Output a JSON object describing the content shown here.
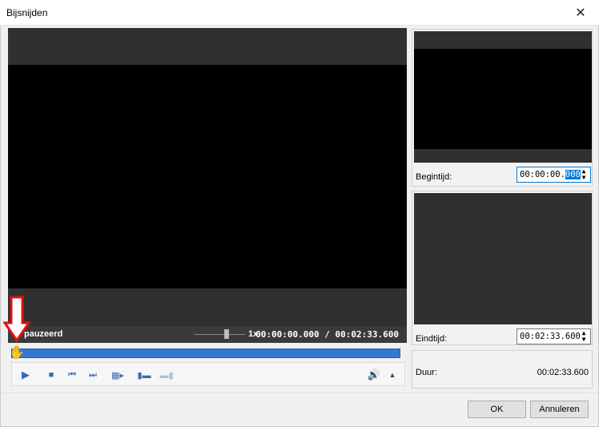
{
  "window": {
    "title": "Bijsnijden",
    "close_glyph": "✕"
  },
  "player": {
    "status": "pauzeerd",
    "speed": "1x",
    "timecode": "00:00:00.000 / 00:02:33.600",
    "seek_position": 0.0
  },
  "controls": {
    "play_icon": "▶",
    "stop_icon": "■",
    "prev_icon": "⏮",
    "next_icon": "⏭",
    "mark_icon": "▦▸",
    "set_start_icon": "▮▬",
    "set_end_icon": "▬▮",
    "volume_icon": "🔊",
    "volume_menu_icon": "▲"
  },
  "trim": {
    "start_label": "Begintijd:",
    "start_value_main": "00:00:00.",
    "start_value_selected": "000",
    "end_label": "Eindtijd:",
    "end_value": "00:02:33.600",
    "duration_label": "Duur:",
    "duration_value": "00:02:33.600"
  },
  "buttons": {
    "ok": "OK",
    "cancel": "Annuleren"
  },
  "colors": {
    "accent": "#0078d7",
    "seekbar": "#3478d4",
    "arrow": "#e01010"
  }
}
